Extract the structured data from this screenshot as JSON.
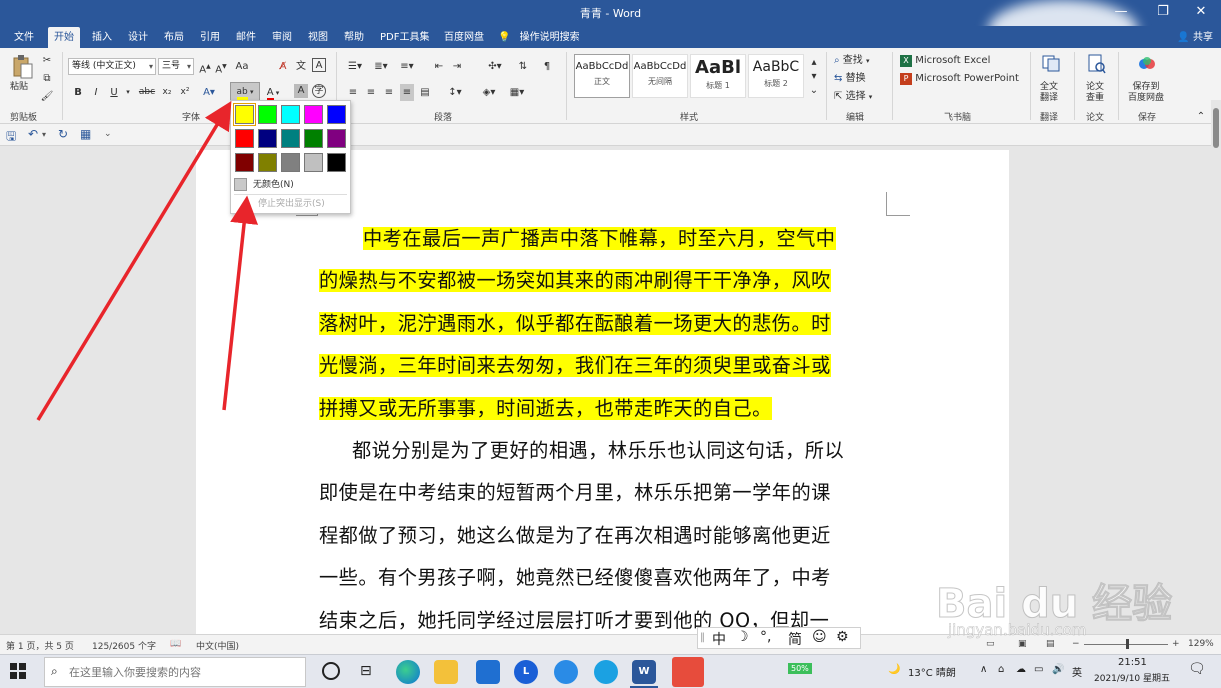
{
  "window": {
    "title": "青青 - Word"
  },
  "menu": {
    "tabs": [
      "文件",
      "开始",
      "插入",
      "设计",
      "布局",
      "引用",
      "邮件",
      "审阅",
      "视图",
      "帮助",
      "PDF工具集",
      "百度网盘"
    ],
    "active_tab": "开始",
    "tell_me": "操作说明搜索",
    "share": "共享"
  },
  "ribbon": {
    "groups": [
      "剪贴板",
      "字体",
      "段落",
      "样式",
      "编辑",
      "飞书脑",
      "翻译",
      "论文",
      "保存"
    ],
    "clipboard": {
      "paste": "粘贴"
    },
    "font": {
      "font_name": "等线 (中文正文)",
      "font_size": "三号"
    },
    "styles": [
      {
        "preview": "AaBbCcDd",
        "name": "正文"
      },
      {
        "preview": "AaBbCcDd",
        "name": "无间隔"
      },
      {
        "preview": "AaBl",
        "name": "标题 1"
      },
      {
        "preview": "AaBbC",
        "name": "标题 2"
      }
    ],
    "editing": {
      "find": "查找",
      "replace": "替换",
      "select": "选择"
    },
    "apps": {
      "excel": "Microsoft Excel",
      "powerpoint": "Microsoft PowerPoint"
    },
    "translate": {
      "line1": "全文",
      "line2": "翻译"
    },
    "paper": {
      "line1": "论文",
      "line2": "查重"
    },
    "save": {
      "line1": "保存到",
      "line2": "百度网盘"
    }
  },
  "highlight_dropdown": {
    "colors": [
      "#ffff00",
      "#00ff00",
      "#00ffff",
      "#ff00ff",
      "#0000ff",
      "#ff0000",
      "#000080",
      "#008080",
      "#008000",
      "#800080",
      "#800000",
      "#808000",
      "#808080",
      "#c0c0c0",
      "#000000"
    ],
    "selected_index": 0,
    "no_color": "无颜色(N)",
    "stop_highlight": "停止突出显示(S)"
  },
  "document": {
    "paragraph1_lines": [
      "中考在最后一声广播声中落下帷幕，时至六月，空气中",
      "的燥热与不安都被一场突如其来的雨冲刷得干干净净，风吹",
      "落树叶，泥泞遇雨水，似乎都在酝酿着一场更大的悲伤。时",
      "光慢淌，三年时间来去匆匆，我们在三年的须臾里或奋斗或",
      "拼搏又或无所事事，时间逝去，也带走昨天的自己。"
    ],
    "paragraph2_lines": [
      "都说分别是为了更好的相遇，林乐乐也认同这句话，所以",
      "即使是在中考结束的短暂两个月里，林乐乐把第一学年的课",
      "程都做了预习，她这么做是为了在再次相遇时能够离他更近",
      "一些。有个男孩子啊，她竟然已经傻傻喜欢他两年了，中考",
      "结束之后，她托同学经过层层打听才要到他的 QQ，但却一"
    ]
  },
  "status_bar": {
    "page": "第 1 页，共 5 页",
    "words": "125/2605 个字",
    "language": "中文(中国)",
    "zoom": "129%"
  },
  "ime": {
    "mode": "中",
    "punct": "°,",
    "charset": "简"
  },
  "taskbar": {
    "search_placeholder": "在这里输入你要搜索的内容",
    "battery": "50%",
    "weather": "13°C  晴朗",
    "lang": "英",
    "time": "21:51",
    "date": "2021/9/10 星期五"
  },
  "watermark": {
    "brand": "Bai du 经验",
    "url": "jingyan.baidu.com"
  }
}
